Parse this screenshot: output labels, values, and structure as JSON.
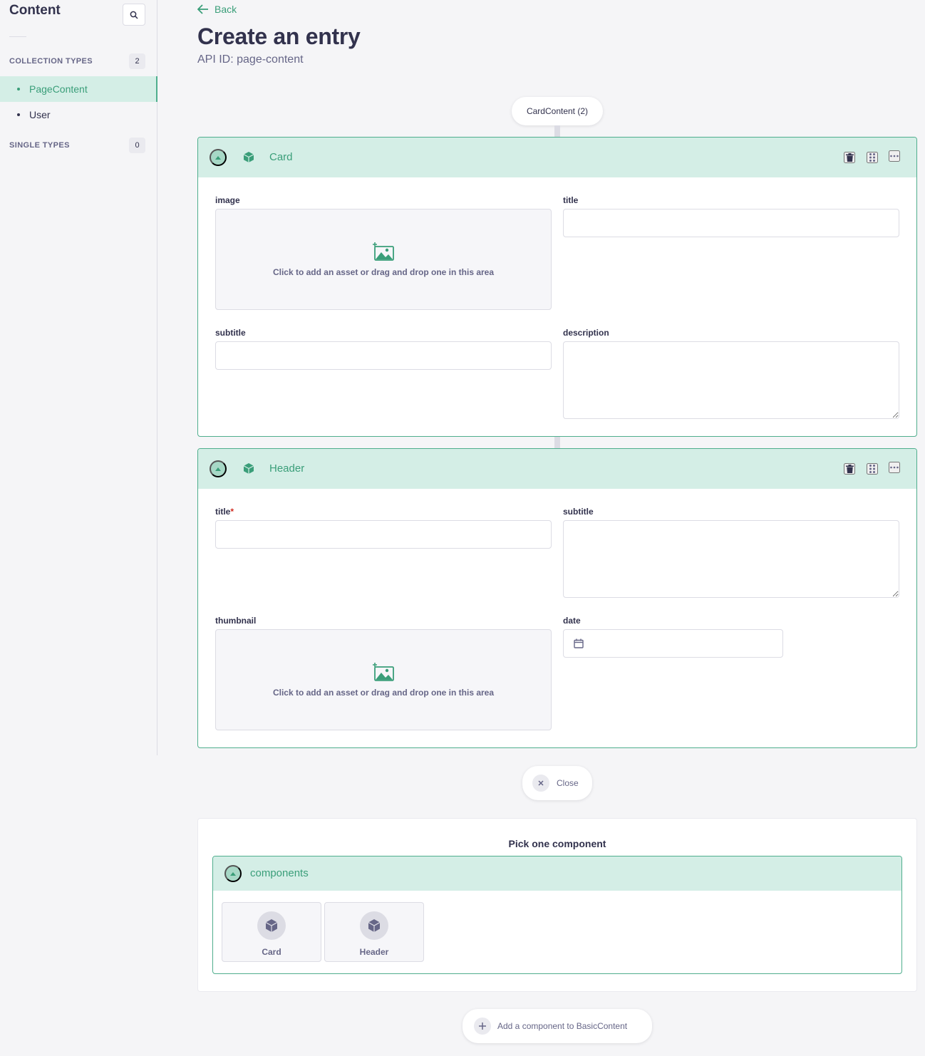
{
  "sidebar": {
    "title": "Content",
    "collection_types": {
      "label": "COLLECTION TYPES",
      "count": "2"
    },
    "items": [
      {
        "label": "PageContent",
        "active": true
      },
      {
        "label": "User",
        "active": false
      }
    ],
    "single_types": {
      "label": "SINGLE TYPES",
      "count": "0"
    }
  },
  "header": {
    "back_label": "Back",
    "title": "Create an entry",
    "api_id": "API ID: page-content"
  },
  "dynamic_zone": {
    "pill_label": "CardContent (2)",
    "blocks": [
      {
        "name": "Card",
        "fields": {
          "image": "image",
          "title": "title",
          "subtitle": "subtitle",
          "description": "description",
          "dropzone_text": "Click to add an asset or drag and drop one in this area"
        }
      },
      {
        "name": "Header",
        "fields": {
          "title": "title",
          "title_required": "*",
          "subtitle": "subtitle",
          "thumbnail": "thumbnail",
          "date": "date",
          "dropzone_text": "Click to add an asset or drag and drop one in this area"
        }
      }
    ],
    "close_label": "Close"
  },
  "picker": {
    "title": "Pick one component",
    "group_name": "components",
    "components": [
      "Card",
      "Header"
    ]
  },
  "add_component_label": "Add a component to BasicContent",
  "colors": {
    "accent": "#4fae8d",
    "accent_text": "#3a9e79",
    "accent_bg": "#d4eee6",
    "text": "#32324d",
    "muted": "#666687",
    "required": "#d02b20"
  },
  "icons": [
    "search-icon",
    "arrow-left-icon",
    "chevron-up-icon",
    "cube-icon",
    "trash-icon",
    "drag-icon",
    "more-icon",
    "image-add-icon",
    "calendar-icon",
    "close-icon",
    "plus-icon"
  ]
}
